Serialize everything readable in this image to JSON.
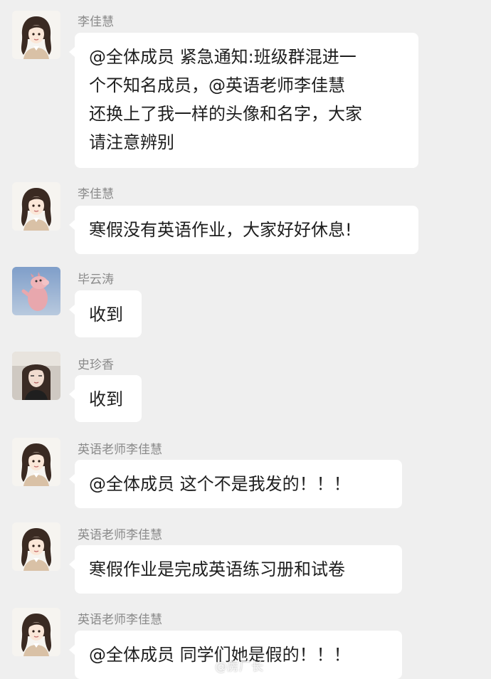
{
  "messages": [
    {
      "sender": "李佳慧",
      "avatar": "teacher-avatar-icon",
      "text": "@全体成员 紧急通知:班级群混进一\n个不知名成员，@英语老师李佳慧\n还换上了我一样的头像和名字，大家\n请注意辨别"
    },
    {
      "sender": "李佳慧",
      "avatar": "teacher-avatar-icon",
      "text": "寒假没有英语作业，大家好好休息!"
    },
    {
      "sender": "毕云涛",
      "avatar": "pink-toy-avatar-icon",
      "text": "收到"
    },
    {
      "sender": "史珍香",
      "avatar": "girl-photo-avatar-icon",
      "text": "收到"
    },
    {
      "sender": "英语老师李佳慧",
      "avatar": "teacher-avatar-icon",
      "text": "@全体成员 这个不是我发的！！！"
    },
    {
      "sender": "英语老师李佳慧",
      "avatar": "teacher-avatar-icon",
      "text": "寒假作业是完成英语练习册和试卷"
    },
    {
      "sender": "英语老师李佳慧",
      "avatar": "teacher-avatar-icon",
      "text": "@全体成员 同学们她是假的！！！"
    }
  ],
  "watermark": "@房厂长"
}
